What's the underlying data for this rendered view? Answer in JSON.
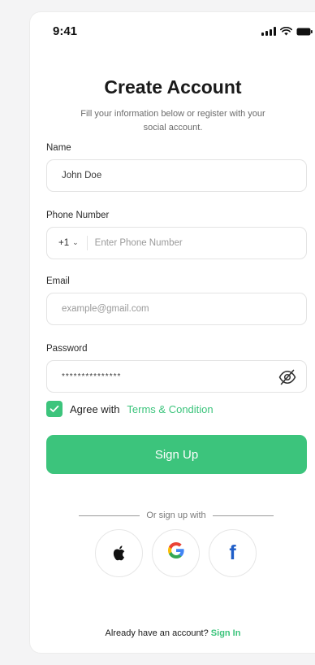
{
  "status_bar": {
    "time": "9:41"
  },
  "header": {
    "title": "Create Account",
    "subtitle": "Fill your information below or register with your social account."
  },
  "form": {
    "name": {
      "label": "Name",
      "value": "John Doe"
    },
    "phone": {
      "label": "Phone Number",
      "country_code": "+1",
      "placeholder": "Enter Phone Number"
    },
    "email": {
      "label": "Email",
      "placeholder": "example@gmail.com"
    },
    "password": {
      "label": "Password",
      "value": "***************"
    },
    "agree": {
      "checked": true,
      "text": "Agree with",
      "link": "Terms & Condition"
    },
    "submit_label": "Sign Up"
  },
  "social": {
    "divider_text": "Or sign up with",
    "providers": [
      "apple",
      "google",
      "facebook"
    ],
    "google_glyph": "G",
    "facebook_glyph": "f"
  },
  "footer": {
    "prompt": "Already  have an account?",
    "link": "Sign In"
  },
  "colors": {
    "accent": "#3cc47c",
    "facebook": "#1f5ec8"
  },
  "icons": [
    "signal-icon",
    "wifi-icon",
    "battery-icon",
    "chevron-down-icon",
    "eye-off-icon",
    "check-icon",
    "apple-icon",
    "google-icon",
    "facebook-icon"
  ]
}
